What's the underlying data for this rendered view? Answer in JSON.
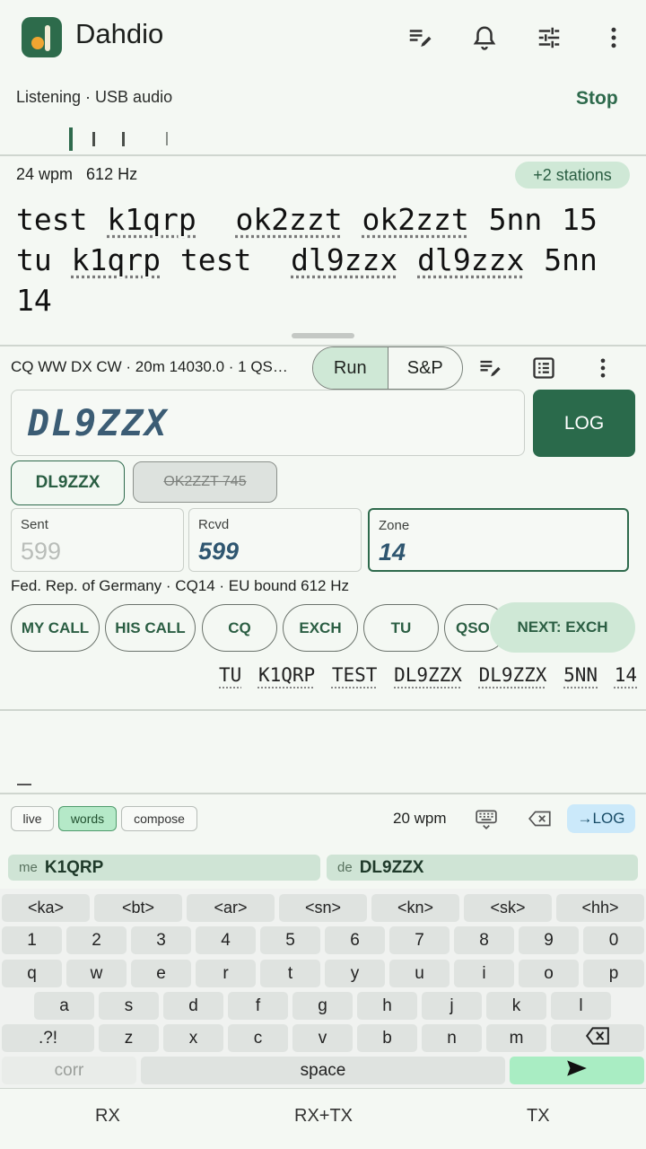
{
  "app": {
    "title": "Dahdio"
  },
  "toolbar": {
    "icons": [
      "edit-list-icon",
      "bell-icon",
      "tune-icon",
      "more-vert-icon"
    ]
  },
  "status": {
    "text": "Listening · USB audio",
    "stop_label": "Stop"
  },
  "decoder": {
    "wpm": "24 wpm",
    "freq": "612 Hz",
    "stations_chip": "+2 stations",
    "line1": [
      "test",
      "k1qrp",
      "ok2zzt",
      "ok2zzt",
      "5nn",
      "15"
    ],
    "line2": [
      "tu",
      "k1qrp",
      "test",
      "dl9zzx",
      "dl9zzx",
      "5nn"
    ],
    "line3": [
      "14"
    ]
  },
  "contest": {
    "summary": "CQ WW DX CW · 20m 14030.0 · 1 QS…",
    "mode_run": "Run",
    "mode_sp": "S&P"
  },
  "entry": {
    "call": "DL9ZZX",
    "log_label": "LOG",
    "chip_current": "DL9ZZX",
    "chip_prev": "OK2ZZT 745",
    "sent_label": "Sent",
    "sent_value": "599",
    "rcvd_label": "Rcvd",
    "rcvd_value": "599",
    "zone_label": "Zone",
    "zone_value": "14",
    "country_info": "Fed. Rep. of Germany · CQ14 · EU  bound 612 Hz"
  },
  "macros": [
    "MY CALL",
    "HIS CALL",
    "CQ",
    "EXCH",
    "TU",
    "QSO"
  ],
  "next_label": "NEXT: EXCH",
  "tx_text": [
    "TU",
    "K1QRP",
    "TEST",
    "DL9ZZX",
    "DL9ZZX",
    "5NN",
    "14"
  ],
  "keyboard_bar": {
    "modes": [
      "live",
      "words",
      "compose"
    ],
    "wpm": "20 wpm",
    "tolog_label": "→LOG",
    "me_label": "me",
    "me_call": "K1QRP",
    "de_label": "de",
    "de_call": "DL9ZZX"
  },
  "keyboard": {
    "prosigns": [
      "<ka>",
      "<bt>",
      "<ar>",
      "<sn>",
      "<kn>",
      "<sk>",
      "<hh>"
    ],
    "digits": [
      "1",
      "2",
      "3",
      "4",
      "5",
      "6",
      "7",
      "8",
      "9",
      "0"
    ],
    "row1": [
      "q",
      "w",
      "e",
      "r",
      "t",
      "y",
      "u",
      "i",
      "o",
      "p"
    ],
    "row2": [
      "a",
      "s",
      "d",
      "f",
      "g",
      "h",
      "j",
      "k",
      "l"
    ],
    "row3": [
      ".?!",
      "z",
      "x",
      "c",
      "v",
      "b",
      "n",
      "m"
    ],
    "corr": "corr",
    "space": "space"
  },
  "bottom_nav": [
    "RX",
    "RX+TX",
    "TX"
  ],
  "colors": {
    "primary": "#2a6a4b",
    "accent_chip": "#cfe8d6",
    "logo_dot": "#f0a531"
  }
}
